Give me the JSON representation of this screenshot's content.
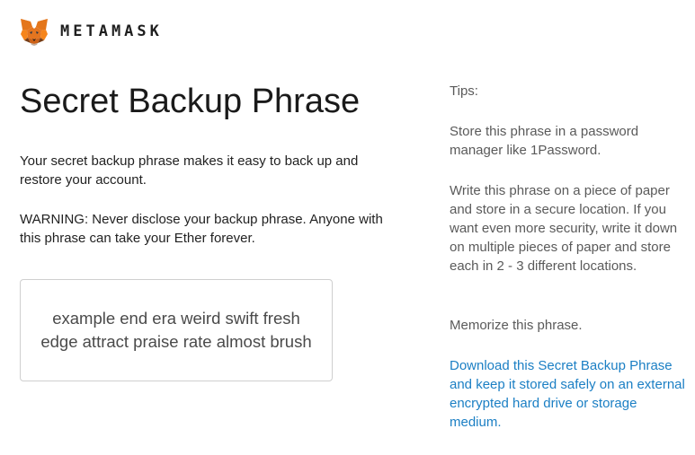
{
  "header": {
    "brand": "METAMASK",
    "logo_icon": "metamask-fox-icon"
  },
  "main": {
    "title": "Secret Backup Phrase",
    "description": "Your secret backup phrase makes it easy to back up and restore your account.",
    "warning": "WARNING: Never disclose your backup phrase. Anyone with this phrase can take your Ether forever.",
    "phrase": "example end era weird swift fresh edge attract praise rate almost brush"
  },
  "tips": {
    "heading": "Tips:",
    "items": [
      "Store this phrase in a password manager like 1Password.",
      "Write this phrase on a piece of paper and store in a secure location. If you want even more security, write it down on multiple pieces of paper and store each in 2 - 3 different locations.",
      "Memorize this phrase."
    ],
    "download_link": "Download this Secret Backup Phrase and keep it stored safely on an external encrypted hard drive or storage medium."
  },
  "colors": {
    "link": "#1b7fc4",
    "fox_orange": "#e2761b",
    "fox_dark": "#763d16"
  }
}
